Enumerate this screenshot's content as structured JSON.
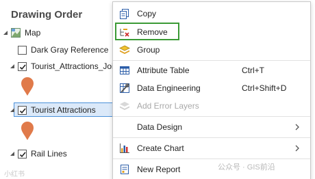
{
  "pane": {
    "title": "Drawing Order",
    "items": [
      {
        "label": "Map"
      },
      {
        "label": "Dark Gray Reference"
      },
      {
        "label": "Tourist_Attractions_Joined"
      },
      {
        "label": "Tourist Attractions"
      },
      {
        "label": "Rail Lines"
      }
    ]
  },
  "menu": {
    "items": [
      {
        "label": "Copy",
        "icon": "copy-icon"
      },
      {
        "label": "Remove",
        "icon": "remove-icon"
      },
      {
        "label": "Group",
        "icon": "group-icon"
      },
      {
        "label": "Attribute Table",
        "shortcut": "Ctrl+T",
        "icon": "table-icon"
      },
      {
        "label": "Data Engineering",
        "shortcut": "Ctrl+Shift+D",
        "icon": "data-engineering-icon"
      },
      {
        "label": "Add Error Layers",
        "icon": "error-layers-icon",
        "disabled": true
      },
      {
        "label": "Data Design"
      },
      {
        "label": "Create Chart",
        "icon": "chart-icon"
      },
      {
        "label": "New Report",
        "icon": "report-icon"
      }
    ]
  },
  "watermark": {
    "right": "公众号 · GIS前沿",
    "left": "小红书"
  },
  "colors": {
    "highlight": "#3a9a35",
    "selection": "#dbe9f9",
    "pin": "#e07a4a"
  }
}
